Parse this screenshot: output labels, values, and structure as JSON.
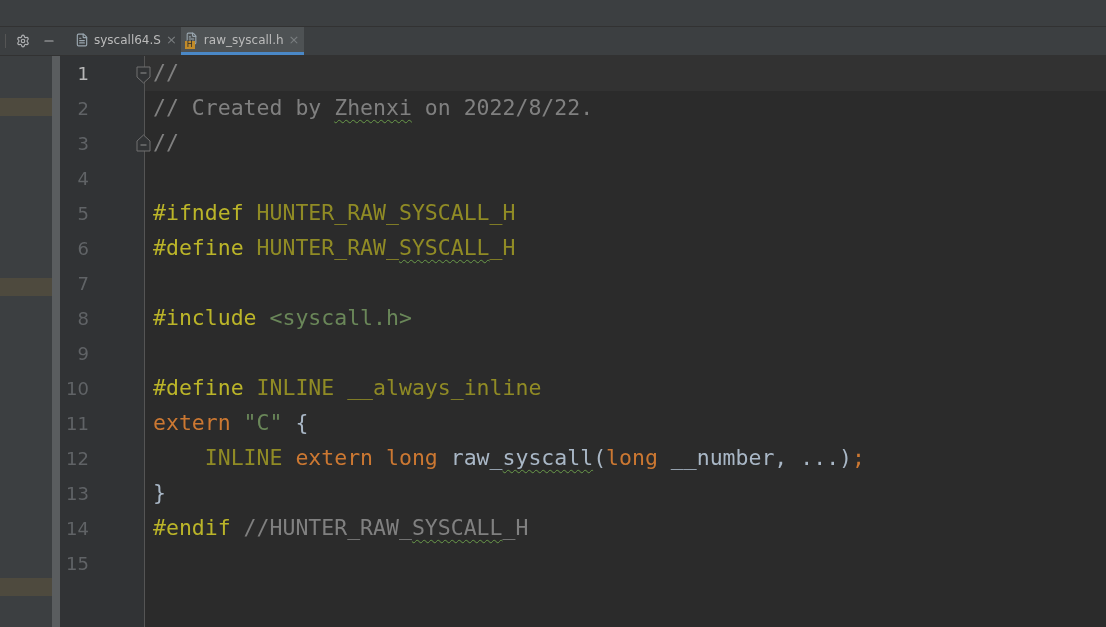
{
  "tabs": [
    {
      "label": "syscall64.S",
      "kind": "asm",
      "selected": false,
      "close": "×"
    },
    {
      "label": "raw_syscall.h",
      "kind": "header",
      "selected": true,
      "close": "×",
      "badge": "H"
    }
  ],
  "editor": {
    "lines": [
      {
        "number": "1",
        "current": true,
        "fold_start": true,
        "tokens": [
          {
            "text": "//",
            "kind": "comment"
          }
        ]
      },
      {
        "number": "2",
        "current": false,
        "tokens": [
          {
            "text": "// Created by ",
            "kind": "comment"
          },
          {
            "text": "Zhenxi",
            "kind": "comment",
            "typo": true
          },
          {
            "text": " on 2022/8/22.",
            "kind": "comment"
          }
        ]
      },
      {
        "number": "3",
        "current": false,
        "fold_end": true,
        "tokens": [
          {
            "text": "//",
            "kind": "comment"
          }
        ]
      },
      {
        "number": "4",
        "current": false
      },
      {
        "number": "5",
        "current": false,
        "tokens": [
          {
            "text": "#ifndef ",
            "kind": "directive"
          },
          {
            "text": "HUNTER_RAW_SYSCALL_H",
            "kind": "macro"
          }
        ]
      },
      {
        "number": "6",
        "current": false,
        "tokens": [
          {
            "text": "#define ",
            "kind": "directive"
          },
          {
            "text": "HUNTER_RAW_",
            "kind": "macro"
          },
          {
            "text": "SYSCALL",
            "kind": "macro",
            "typo": true
          },
          {
            "text": "_H",
            "kind": "macro"
          }
        ]
      },
      {
        "number": "7",
        "current": false
      },
      {
        "number": "8",
        "current": false,
        "tokens": [
          {
            "text": "#include ",
            "kind": "directive"
          },
          {
            "text": "<syscall.h>",
            "kind": "string"
          }
        ]
      },
      {
        "number": "9",
        "current": false
      },
      {
        "number": "10",
        "current": false,
        "tokens": [
          {
            "text": "#define ",
            "kind": "directive"
          },
          {
            "text": "INLINE __always_inline",
            "kind": "macro"
          }
        ]
      },
      {
        "number": "11",
        "current": false,
        "tokens": [
          {
            "text": "extern ",
            "kind": "keyword"
          },
          {
            "text": "\"C\"",
            "kind": "string"
          },
          {
            "text": " {",
            "kind": "plain"
          }
        ]
      },
      {
        "number": "12",
        "current": false,
        "tokens": [
          {
            "text": "    INLINE ",
            "kind": "macro"
          },
          {
            "text": "extern long ",
            "kind": "keyword"
          },
          {
            "text": "raw_",
            "kind": "plain"
          },
          {
            "text": "syscall",
            "kind": "plain",
            "typo": true
          },
          {
            "text": "(",
            "kind": "plain"
          },
          {
            "text": "long ",
            "kind": "keyword"
          },
          {
            "text": "__number, ...)",
            "kind": "plain"
          },
          {
            "text": ";",
            "kind": "keyword"
          }
        ]
      },
      {
        "number": "13",
        "current": false,
        "tokens": [
          {
            "text": "}",
            "kind": "plain"
          }
        ]
      },
      {
        "number": "14",
        "current": false,
        "tokens": [
          {
            "text": "#endif ",
            "kind": "directive"
          },
          {
            "text": "//HUNTER_RAW_",
            "kind": "comment"
          },
          {
            "text": "SYSCALL",
            "kind": "comment",
            "typo": true
          },
          {
            "text": "_H",
            "kind": "comment"
          }
        ]
      },
      {
        "number": "15",
        "current": false
      }
    ]
  }
}
